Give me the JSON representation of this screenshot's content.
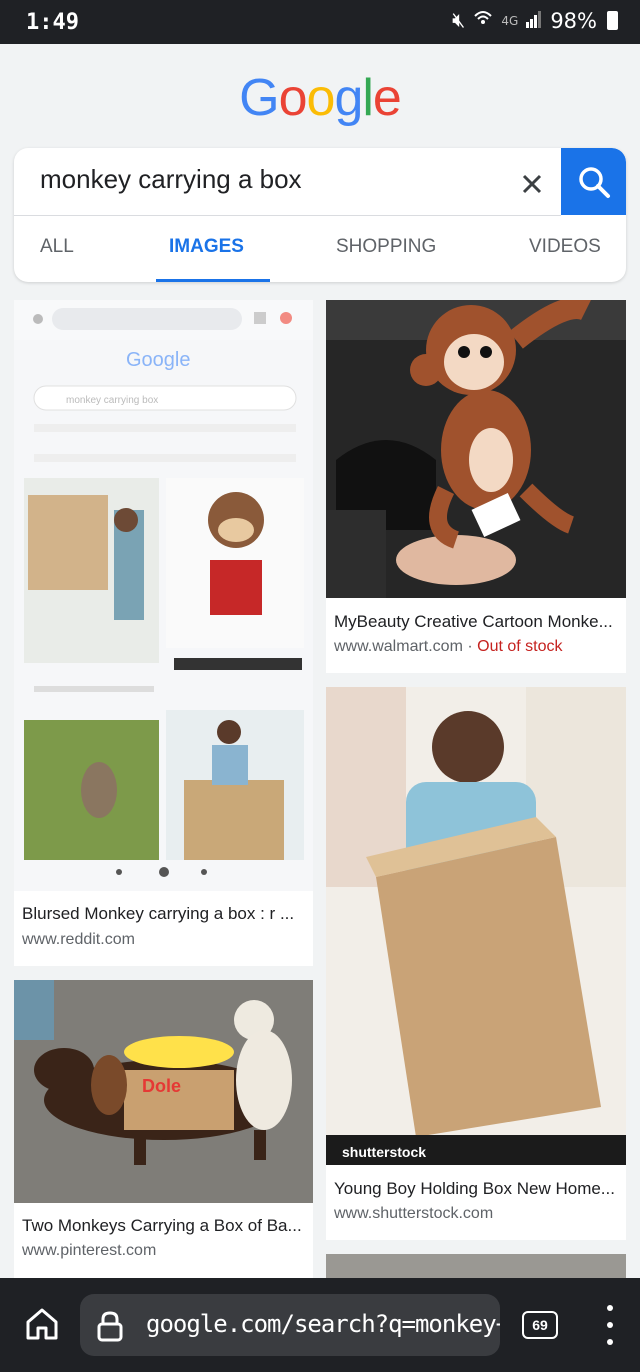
{
  "status_bar": {
    "time": "1:49",
    "network": "4G",
    "battery": "98%"
  },
  "logo": {
    "letters": [
      "G",
      "o",
      "o",
      "g",
      "l",
      "e"
    ],
    "colors": [
      "#4285f4",
      "#ea4335",
      "#fbbc05",
      "#4285f4",
      "#34a853",
      "#ea4335"
    ]
  },
  "search": {
    "query": "monkey carrying a box"
  },
  "tabs": [
    {
      "label": "ALL",
      "active": false
    },
    {
      "label": "IMAGES",
      "active": true
    },
    {
      "label": "SHOPPING",
      "active": false
    },
    {
      "label": "VIDEOS",
      "active": false
    }
  ],
  "results": [
    {
      "title": "MyBeauty Creative Cartoon Monke...",
      "source": "www.walmart.com",
      "separator": " · ",
      "badge": "Out of stock",
      "image": "plush-monkey-tissue-holder"
    },
    {
      "title": "Blursed Monkey carrying a box : r ...",
      "source": "www.reddit.com",
      "image": "screenshot-of-search-results"
    },
    {
      "title": "Young Boy Holding Box New Home...",
      "source": "www.shutterstock.com",
      "image": "boy-holding-box",
      "watermark": "shutterstock"
    },
    {
      "title": "Two Monkeys Carrying a Box of Ba...",
      "source": "www.pinterest.com",
      "image": "dog-with-monkeys-banana-box",
      "box_label": "Dole"
    }
  ],
  "screenshot_thumb": {
    "logo": "Google",
    "query": "monkey carrying box"
  },
  "bottom_bar": {
    "url": "google.com/search?q=monkey+c",
    "tab_count": "69"
  },
  "colors": {
    "accent": "#1a73e8",
    "out_of_stock": "#c5221f",
    "system_bar": "#1f2125"
  }
}
